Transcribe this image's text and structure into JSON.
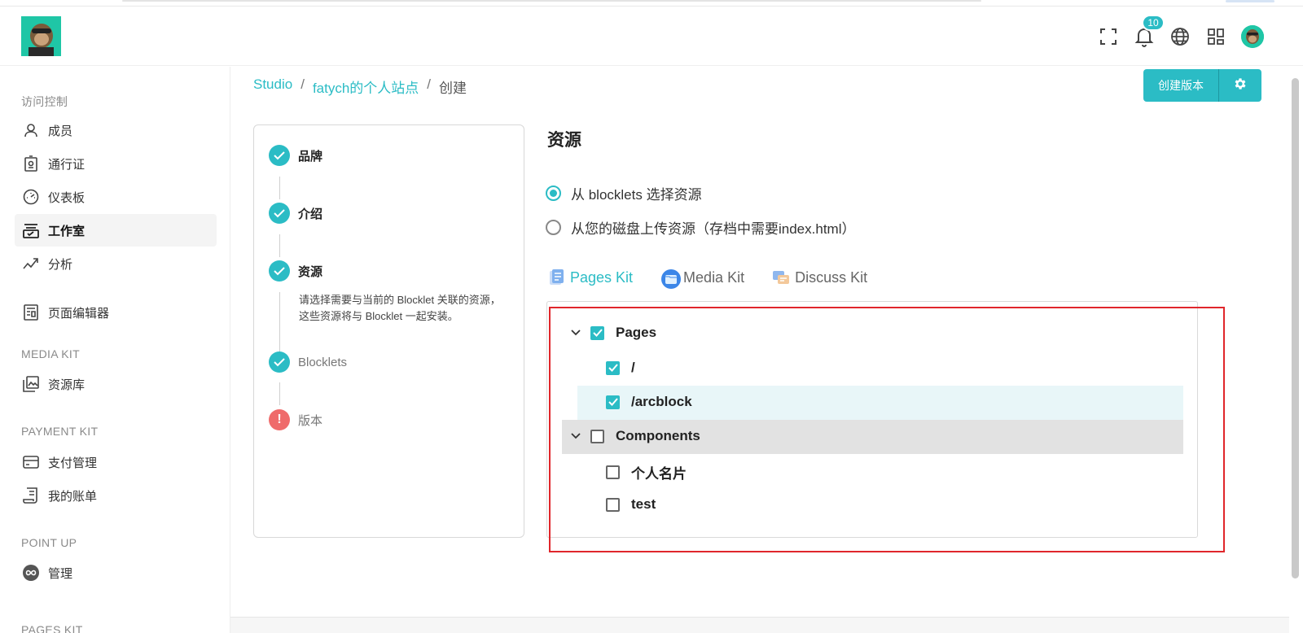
{
  "header": {
    "notification_count": "10"
  },
  "sidebar": {
    "sections": [
      {
        "title": "访问控制"
      },
      {
        "title": "MEDIA KIT"
      },
      {
        "title": "PAYMENT KIT"
      },
      {
        "title": "POINT UP"
      },
      {
        "title": "PAGES KIT"
      }
    ],
    "items": [
      {
        "label": "成员",
        "icon": "user-icon"
      },
      {
        "label": "通行证",
        "icon": "badge-icon"
      },
      {
        "label": "仪表板",
        "icon": "dashboard-icon"
      },
      {
        "label": "工作室",
        "icon": "studio-icon",
        "active": true
      },
      {
        "label": "分析",
        "icon": "analytics-icon"
      },
      {
        "label": "页面编辑器",
        "icon": "page-editor-icon"
      },
      {
        "label": "资源库",
        "icon": "media-library-icon"
      },
      {
        "label": "支付管理",
        "icon": "card-icon"
      },
      {
        "label": "我的账单",
        "icon": "bill-icon"
      },
      {
        "label": "管理",
        "icon": "infinity-icon"
      }
    ]
  },
  "breadcrumb": {
    "items": [
      "Studio",
      "fatych的个人站点",
      "创建"
    ],
    "separator": "/"
  },
  "toolbar": {
    "create_version_label": "创建版本"
  },
  "stepper": {
    "steps": [
      {
        "label": "品牌",
        "status": "done"
      },
      {
        "label": "介绍",
        "status": "done"
      },
      {
        "label": "资源",
        "status": "done",
        "description": "请选择需要与当前的 Blocklet 关联的资源，这些资源将与 Blocklet 一起安装。"
      },
      {
        "label": "Blocklets",
        "status": "done"
      },
      {
        "label": "版本",
        "status": "error"
      }
    ]
  },
  "resources": {
    "title": "资源",
    "options": [
      {
        "label": "从 blocklets 选择资源",
        "selected": true
      },
      {
        "label": "从您的磁盘上传资源（存档中需要index.html）",
        "selected": false
      }
    ],
    "tabs": [
      {
        "label": "Pages Kit",
        "active": true
      },
      {
        "label": "Media Kit",
        "active": false
      },
      {
        "label": "Discuss Kit",
        "active": false
      }
    ],
    "tree": [
      {
        "label": "Pages",
        "checked": true,
        "level": 0,
        "expandable": true
      },
      {
        "label": "/",
        "checked": true,
        "level": 1
      },
      {
        "label": "/arcblock",
        "checked": true,
        "level": 1,
        "hovered": true
      },
      {
        "label": "Components",
        "checked": false,
        "level": 0,
        "expandable": true,
        "selected": true
      },
      {
        "label": "个人名片",
        "checked": false,
        "level": 1
      },
      {
        "label": "test",
        "checked": false,
        "level": 1
      }
    ]
  },
  "colors": {
    "accent": "#2bbcc5",
    "error": "#ef6b6b",
    "highlight_border": "#e0262b"
  }
}
